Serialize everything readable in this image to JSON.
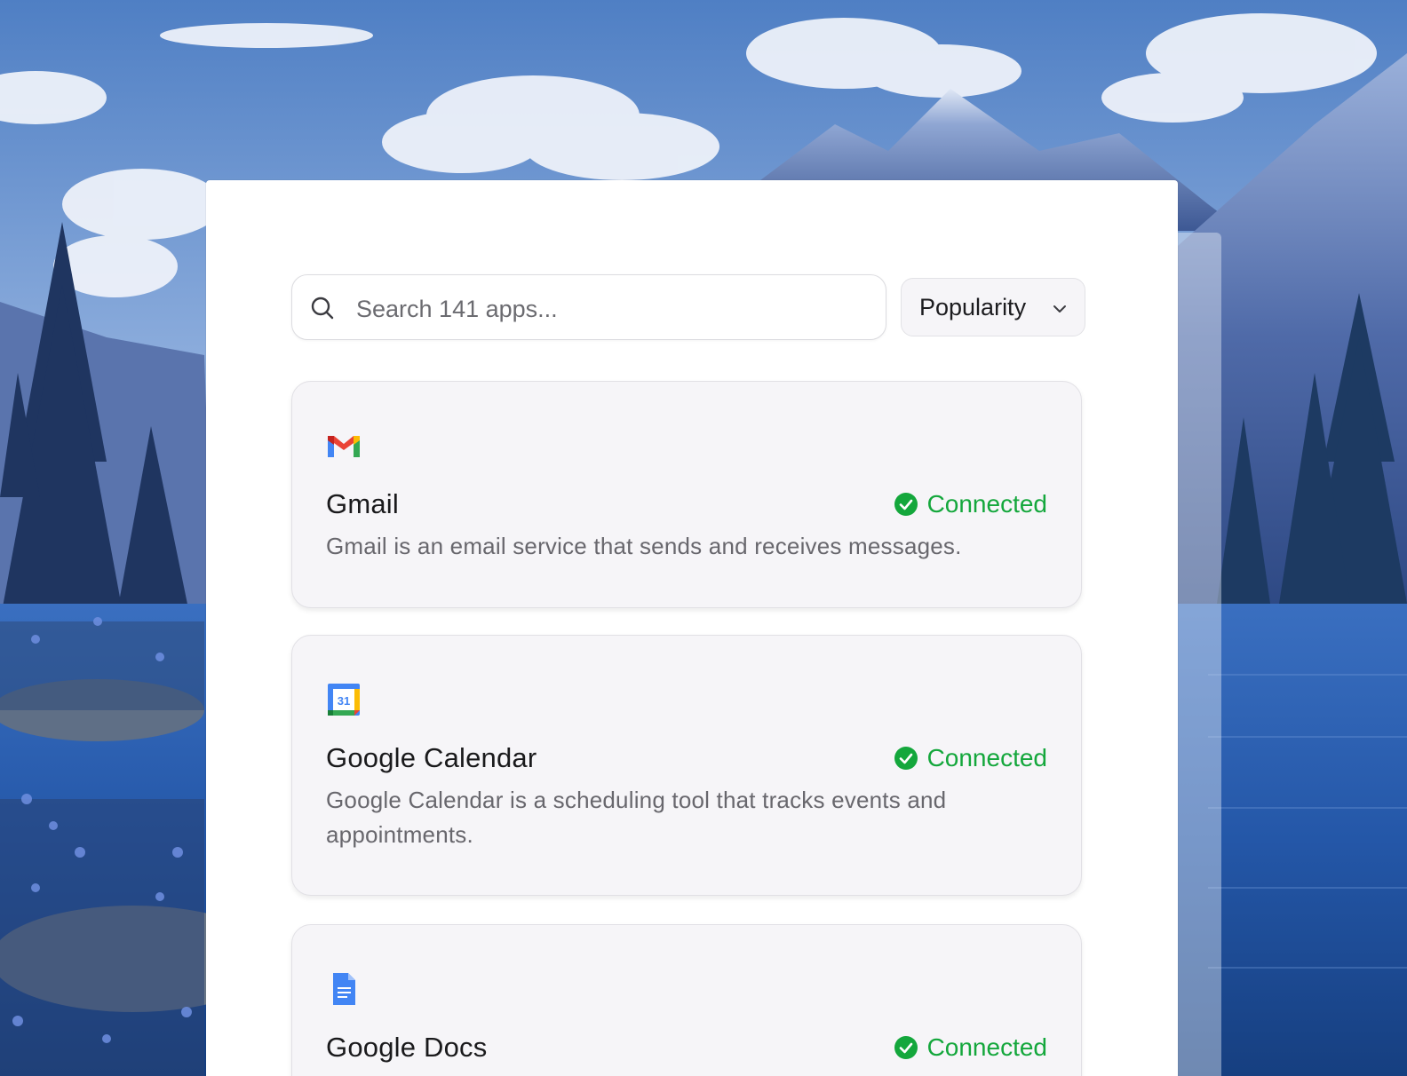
{
  "search": {
    "placeholder": "Search 141 apps..."
  },
  "sort": {
    "selected": "Popularity",
    "icon": "chevron-down-icon"
  },
  "colors": {
    "connected": "#14a73c",
    "card_background": "#f6f5f8"
  },
  "apps": [
    {
      "name": "Gmail",
      "icon": "gmail-icon",
      "status": "Connected",
      "description": "Gmail is an email service that sends and receives messages."
    },
    {
      "name": "Google Calendar",
      "icon": "google-calendar-icon",
      "icon_text": "31",
      "status": "Connected",
      "description": "Google Calendar is a scheduling tool that tracks events and appointments."
    },
    {
      "name": "Google Docs",
      "icon": "google-docs-icon",
      "status": "Connected",
      "description": ""
    }
  ]
}
